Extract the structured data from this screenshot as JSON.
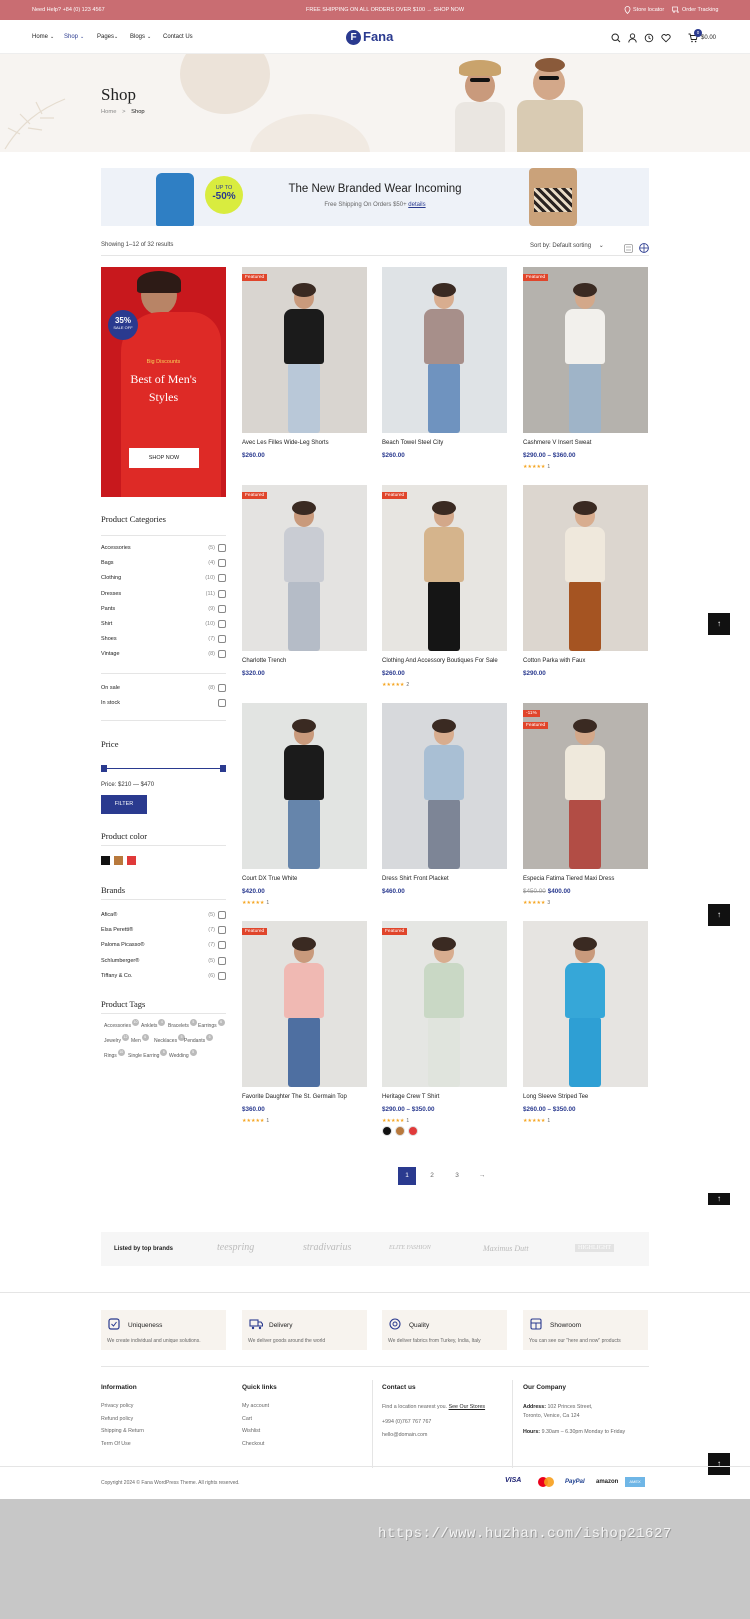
{
  "topbar": {
    "help": "Need Help? +84 (0) 123 4567",
    "promo": "FREE SHIPPING ON ALL ORDERS OVER $100 → SHOP NOW",
    "store_locator": "Store locator",
    "order_tracking": "Order Tracking"
  },
  "header": {
    "nav": [
      "Home",
      "Shop",
      "Pages",
      "Blogs",
      "Contact Us"
    ],
    "logo_text": "Fana",
    "cart_count": "0",
    "cart_total": "$0.00"
  },
  "hero": {
    "title": "Shop",
    "breadcrumb_home": "Home",
    "breadcrumb_sep": ">",
    "breadcrumb_current": "Shop"
  },
  "banner": {
    "badge_top": "UP TO",
    "badge_value": "-50%",
    "title": "The New Branded Wear Incoming",
    "subtitle": "Free Shipping On Orders $50+",
    "link": "details"
  },
  "toolbar": {
    "results": "Showing 1–12 of 32 results",
    "sort_label": "Sort by:",
    "sort_value": "Default sorting"
  },
  "promo_card": {
    "discount": "35%",
    "discount_sub": "SALE OFF",
    "kicker": "Big Discounts",
    "title_line1": "Best of Men's",
    "title_line2": "Styles",
    "button": "SHOP NOW"
  },
  "categories": {
    "title": "Product Categories",
    "items": [
      {
        "name": "Accessories",
        "count": "(5)"
      },
      {
        "name": "Bags",
        "count": "(4)"
      },
      {
        "name": "Clothing",
        "count": "(10)"
      },
      {
        "name": "Dresses",
        "count": "(11)"
      },
      {
        "name": "Pants",
        "count": "(9)"
      },
      {
        "name": "Shirt",
        "count": "(10)"
      },
      {
        "name": "Shoes",
        "count": "(7)"
      },
      {
        "name": "Vintage",
        "count": "(8)"
      }
    ],
    "availability": [
      {
        "name": "On sale",
        "count": "(8)"
      },
      {
        "name": "In stock",
        "count": ""
      }
    ]
  },
  "price_filter": {
    "title": "Price",
    "label": "Price: $210 — $470",
    "button": "FILTER"
  },
  "colors": {
    "title": "Product color",
    "swatches": [
      "#111111",
      "#b8793c",
      "#e03a3a"
    ]
  },
  "brands": {
    "title": "Brands",
    "items": [
      {
        "name": "Afica®",
        "count": "(5)"
      },
      {
        "name": "Elsa Peretti®",
        "count": "(7)"
      },
      {
        "name": "Paloma Picasso®",
        "count": "(7)"
      },
      {
        "name": "Schlumberger®",
        "count": "(5)"
      },
      {
        "name": "Tiffany & Co.",
        "count": "(6)"
      }
    ]
  },
  "tags": {
    "title": "Product Tags",
    "items": [
      {
        "name": "Accessories",
        "count": "10"
      },
      {
        "name": "Anklets",
        "count": "4"
      },
      {
        "name": "Bracelets",
        "count": "5"
      },
      {
        "name": "Earrings",
        "count": "6"
      },
      {
        "name": "Jewelry",
        "count": "12"
      },
      {
        "name": "Men",
        "count": "6"
      },
      {
        "name": "Necklaces",
        "count": "5"
      },
      {
        "name": "Pendants",
        "count": "6"
      },
      {
        "name": "Rings",
        "count": "10"
      },
      {
        "name": "Single Earring",
        "count": "6"
      },
      {
        "name": "Wedding",
        "count": "5"
      }
    ]
  },
  "products": [
    {
      "name": "Avec Les Filles Wide-Leg Shorts",
      "price": "$260.00",
      "old": "",
      "tag": "Featured",
      "tag2": "",
      "rating": "",
      "count": "",
      "bg": "#d9d5d0",
      "top": "#1b1b1b",
      "legs": "#b9c8d8",
      "skin": "#c99a7c"
    },
    {
      "name": "Beach Towel Steel City",
      "price": "$260.00",
      "old": "",
      "tag": "",
      "tag2": "",
      "rating": "",
      "count": "",
      "bg": "#dfe3e6",
      "top": "#a78f8a",
      "legs": "#6f93bf",
      "skin": "#d8ad8f"
    },
    {
      "name": "Cashmere V Insert Sweat",
      "price": "$290.00 – $360.00",
      "old": "",
      "tag": "Featured",
      "tag2": "",
      "rating": "★★★★★",
      "count": "1",
      "bg": "#b5b2ad",
      "top": "#f2f0ec",
      "legs": "#9fb4c8",
      "skin": "#d3a88a"
    },
    {
      "name": "Charlotte Trench",
      "price": "$320.00",
      "old": "",
      "tag": "Featured",
      "tag2": "",
      "rating": "",
      "count": "",
      "bg": "#e4e3e1",
      "top": "#c9ccd3",
      "legs": "#b5bcc7",
      "skin": "#c99a7c"
    },
    {
      "name": "Clothing And Accessory Boutiques For Sale",
      "price": "$260.00",
      "old": "",
      "tag": "Featured",
      "tag2": "",
      "rating": "★★★★★",
      "count": "2",
      "bg": "#e7e5e1",
      "top": "#d5b48c",
      "legs": "#151515",
      "skin": "#d3a88a"
    },
    {
      "name": "Cotton Parka with Faux",
      "price": "$290.00",
      "old": "",
      "tag": "",
      "tag2": "",
      "rating": "",
      "count": "",
      "bg": "#dcd6cf",
      "top": "#efe8dc",
      "legs": "#a55422",
      "skin": "#d8ad8f"
    },
    {
      "name": "Court DX True White",
      "price": "$420.00",
      "old": "",
      "tag": "",
      "tag2": "",
      "rating": "★★★★★",
      "count": "1",
      "bg": "#e2e4e2",
      "top": "#1b1b1b",
      "legs": "#6685ab",
      "skin": "#c99a7c"
    },
    {
      "name": "Dress Shirt Front Placket",
      "price": "$460.00",
      "old": "",
      "tag": "",
      "tag2": "",
      "rating": "",
      "count": "",
      "bg": "#d7d9dc",
      "top": "#a9bfd4",
      "legs": "#7d8596",
      "skin": "#d8ad8f"
    },
    {
      "name": "Especia Fatima Tiered Maxi Dress",
      "price": "$400.00",
      "old": "$450.00",
      "tag": "-11%",
      "tag2": "Featured",
      "rating": "★★★★★",
      "count": "3",
      "bg": "#b8b4af",
      "top": "#efe9dc",
      "legs": "#b24d45",
      "skin": "#d3a88a"
    },
    {
      "name": "Favorite Daughter The St. Germain Top",
      "price": "$360.00",
      "old": "",
      "tag": "Featured",
      "tag2": "",
      "rating": "★★★★★",
      "count": "1",
      "bg": "#e3e2df",
      "top": "#f0b9b3",
      "legs": "#4e6fa1",
      "skin": "#c99a7c"
    },
    {
      "name": "Heritage Crew T Shirt",
      "price": "$290.00 – $350.00",
      "old": "",
      "tag": "Featured",
      "tag2": "",
      "rating": "★★★★★",
      "count": "1",
      "bg": "#e5e6e3",
      "top": "#c9d8c5",
      "legs": "#e0e4dd",
      "skin": "#d8ad8f"
    },
    {
      "name": "Long Sleeve Striped Tee",
      "price": "$260.00 – $350.00",
      "old": "",
      "tag": "",
      "tag2": "",
      "rating": "★★★★★",
      "count": "1",
      "bg": "#e6e4e1",
      "top": "#36a7d8",
      "legs": "#2e9fd4",
      "skin": "#c99a7c"
    }
  ],
  "product_swatches": [
    "#111111",
    "#b8793c",
    "#e03a3a"
  ],
  "pagination": [
    "1",
    "2",
    "3",
    "→"
  ],
  "brands_bar": {
    "label": "Listed by top brands",
    "logos": [
      "teespring",
      "stradivarius",
      "ELITE FASHION",
      "Maximus Dutt",
      "HIGHLIGHT"
    ]
  },
  "features": [
    {
      "title": "Uniqueness",
      "desc": "We create individual and unique solutions."
    },
    {
      "title": "Delivery",
      "desc": "We deliver goods around the world"
    },
    {
      "title": "Quality",
      "desc": "We deliver fabrics from Turkey, India, Italy"
    },
    {
      "title": "Showroom",
      "desc": "You can see our \"here and now\" products"
    }
  ],
  "footer": {
    "information": {
      "title": "Information",
      "links": [
        "Privacy policy",
        "Refund policy",
        "Shipping & Return",
        "Term Of Use"
      ]
    },
    "quick_links": {
      "title": "Quick links",
      "links": [
        "My account",
        "Cart",
        "Wishlist",
        "Checkout"
      ]
    },
    "contact": {
      "title": "Contact us",
      "find": "Find a location nearest you.",
      "see_stores": "See Our Stores",
      "phone": "+994 (0)767 767 767",
      "email": "hello@domain.com"
    },
    "company": {
      "title": "Our Company",
      "address_label": "Address:",
      "address1": "102 Princes Street,",
      "address2": "Toronto, Venice, Ca 124",
      "hours_label": "Hours:",
      "hours": "9.30am – 6.30pm Monday to Friday"
    },
    "copyright": "Copyright 2024 © Fana WordPress Theme. All rights reserved.",
    "payments": [
      "VISA",
      "MC",
      "PayPal",
      "amazon",
      "AMEX"
    ]
  },
  "watermark": "https://www.huzhan.com/ishop21627",
  "colors_theme": {
    "accent": "#2a3a8f",
    "topbar": "#c96d72",
    "sale": "#e0452b"
  }
}
